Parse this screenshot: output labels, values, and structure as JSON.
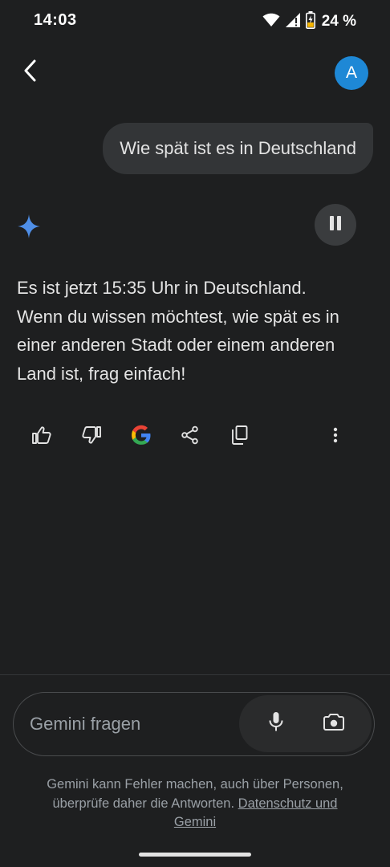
{
  "status_bar": {
    "time": "14:03",
    "battery": "24 %",
    "icons": [
      "wifi-icon",
      "signal-icon",
      "battery-charging-icon"
    ]
  },
  "header": {
    "back_icon": "chevron-left-icon",
    "avatar_letter": "A",
    "avatar_color": "#1e88d6"
  },
  "conversation": {
    "user_message": "Wie spät ist es in Deutschland",
    "response_lines": [
      "Es ist jetzt 15:35 Uhr in Deutschland.",
      "Wenn du wissen möchtest, wie spät es in",
      "einer anderen Stadt oder einem anderen",
      "Land ist, frag einfach!"
    ],
    "gemini_icon": "gemini-star-icon",
    "gemini_color": "#4f8fe8",
    "pause_icon": "pause-icon"
  },
  "actions": [
    "thumbs-up-icon",
    "thumbs-down-icon",
    "google-icon",
    "share-icon",
    "copy-icon",
    "more-vertical-icon"
  ],
  "composer": {
    "placeholder": "Gemini fragen",
    "tools": [
      "microphone-icon",
      "camera-icon"
    ]
  },
  "footer": {
    "disclaimer_line1": "Gemini kann Fehler machen, auch über Personen,",
    "disclaimer_line2_prefix": "überprüfe daher die Antworten. ",
    "link_part1": "Datenschutz und",
    "link_part2": "Gemini"
  },
  "colors": {
    "background": "#1e1f20",
    "bubble": "#333537",
    "text": "#e3e3e3",
    "muted": "#9aa0a6"
  }
}
